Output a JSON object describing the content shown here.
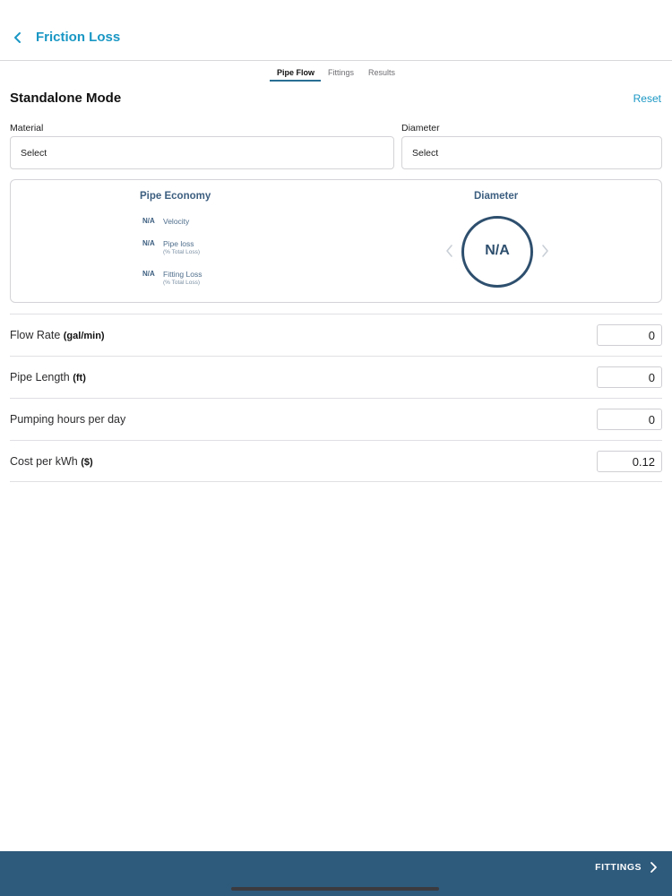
{
  "nav": {
    "title": "Friction Loss",
    "back_icon": "chevron-left-icon"
  },
  "tabs": [
    {
      "label": "Pipe Flow",
      "active": true
    },
    {
      "label": "Fittings",
      "active": false
    },
    {
      "label": "Results",
      "active": false
    }
  ],
  "section": {
    "title": "Standalone Mode",
    "reset_label": "Reset"
  },
  "material": {
    "label": "Material",
    "value": "Select"
  },
  "diameter_select": {
    "label": "Diameter",
    "value": "Select"
  },
  "economy": {
    "title": "Pipe Economy",
    "metrics": [
      {
        "value": "N/A",
        "label": "Velocity",
        "sub": ""
      },
      {
        "value": "N/A",
        "label": "Pipe loss",
        "sub": "(% Total Loss)"
      },
      {
        "value": "N/A",
        "label": "Fitting Loss",
        "sub": "(% Total Loss)"
      }
    ],
    "diameter_title": "Diameter",
    "diameter_value": "N/A"
  },
  "inputs": [
    {
      "label": "Flow Rate",
      "unit": "(gal/min)",
      "value": "0"
    },
    {
      "label": "Pipe Length",
      "unit": "(ft)",
      "value": "0"
    },
    {
      "label": "Pumping hours per day",
      "unit": "",
      "value": "0"
    },
    {
      "label": "Cost per kWh",
      "unit": "($)",
      "value": "0.12"
    }
  ],
  "footer": {
    "next_label": "FITTINGS",
    "next_icon": "chevron-right-icon"
  },
  "colors": {
    "accent": "#1a97c4",
    "navy": "#2e5a7c",
    "card_text": "#3d5f80"
  }
}
